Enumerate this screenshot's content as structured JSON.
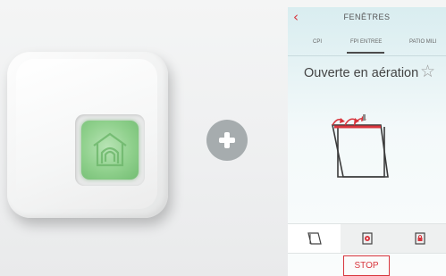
{
  "device": {
    "icon": "house-icon",
    "accent_color": "#8fd08c"
  },
  "plus": {
    "icon": "plus-icon",
    "color": "#a6acae"
  },
  "app": {
    "header": {
      "title": "FENÊTRES",
      "back_icon": "chevron-left-icon",
      "back_glyph": "‹"
    },
    "tabs": [
      {
        "label": "CPI",
        "selected": false
      },
      {
        "label": "FPI ENTREE",
        "selected": true
      },
      {
        "label": "PATIO MILI",
        "selected": false
      }
    ],
    "status": {
      "text": "Ouverte en aération",
      "favorite_icon": "star-icon",
      "favorite_glyph": "☆"
    },
    "modes": [
      {
        "icon": "window-tilt-icon",
        "selected": true
      },
      {
        "icon": "window-ventilation-icon",
        "selected": false
      },
      {
        "icon": "window-locked-icon",
        "selected": false
      }
    ],
    "stop_label": "STOP",
    "accent_color": "#d8353d"
  }
}
